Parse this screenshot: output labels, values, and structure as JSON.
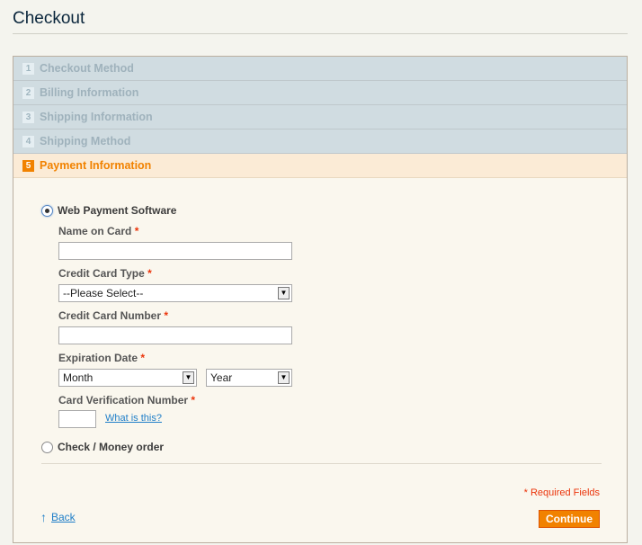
{
  "page": {
    "title": "Checkout"
  },
  "steps": [
    {
      "number": "1",
      "label": "Checkout Method"
    },
    {
      "number": "2",
      "label": "Billing Information"
    },
    {
      "number": "3",
      "label": "Shipping Information"
    },
    {
      "number": "4",
      "label": "Shipping Method"
    },
    {
      "number": "5",
      "label": "Payment Information"
    }
  ],
  "payment": {
    "options": {
      "web": "Web Payment Software",
      "check": "Check / Money order"
    },
    "fields": {
      "name_on_card": "Name on Card",
      "cc_type": "Credit Card Type",
      "cc_type_selected": "--Please Select--",
      "cc_number": "Credit Card Number",
      "expiration": "Expiration Date",
      "month_selected": "Month",
      "year_selected": "Year",
      "cvv": "Card Verification Number",
      "what_is_this": "What is this?"
    },
    "required_marker": "*",
    "required_note": "* Required Fields",
    "back": "Back",
    "continue": "Continue"
  },
  "colors": {
    "accent": "#f18200",
    "link": "#1e7ec8",
    "required": "#eb340a",
    "step_inactive_bg": "#d0dce1",
    "step_active_bg": "#fbebd6"
  }
}
